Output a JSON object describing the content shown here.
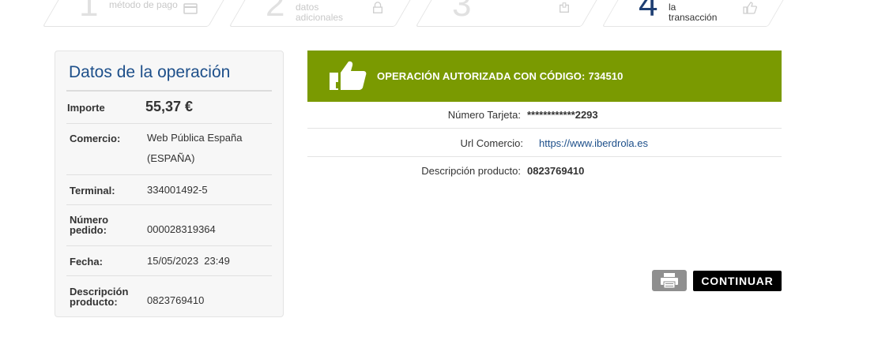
{
  "steps": [
    {
      "num": "1",
      "label_lines": [
        "método de pago"
      ],
      "icon": "card-icon",
      "active": false
    },
    {
      "num": "2",
      "label_lines": [
        "datos",
        "adicionales"
      ],
      "icon": "lock-icon",
      "active": false
    },
    {
      "num": "3",
      "label_lines": [
        ""
      ],
      "icon": "device-icon",
      "active": false
    },
    {
      "num": "4",
      "label_lines": [
        "la",
        "transacción"
      ],
      "icon": "thumbs-up-icon",
      "active": true
    }
  ],
  "panel": {
    "title": "Datos de la operación",
    "rows": [
      {
        "label": "Importe",
        "value": "55,37 €"
      },
      {
        "label": "Comercio:",
        "value_lines": [
          "Web Pública España",
          "(ESPAÑA)"
        ]
      },
      {
        "label": "Terminal:",
        "value": "334001492-5"
      },
      {
        "label_lines": [
          "Número",
          "pedido:"
        ],
        "value": "000028319364"
      },
      {
        "label": "Fecha:",
        "value": "15/05/2023  23:49"
      },
      {
        "label_lines": [
          "Descripción",
          "producto:"
        ],
        "value": "0823769410"
      }
    ]
  },
  "banner": {
    "text": "OPERACIÓN AUTORIZADA CON CÓDIGO:",
    "code": "734510",
    "icon": "thumbs-up-icon",
    "bg_color": "#7a9a01"
  },
  "details": [
    {
      "label": "Número Tarjeta:",
      "value": "************2293"
    },
    {
      "label": "Url Comercio:",
      "value": "https://www.iberdrola.es"
    },
    {
      "label": "Descripción producto:",
      "value": "0823769410"
    }
  ],
  "actions": {
    "print_icon": "printer-icon",
    "continue_label": "CONTINUAR"
  }
}
